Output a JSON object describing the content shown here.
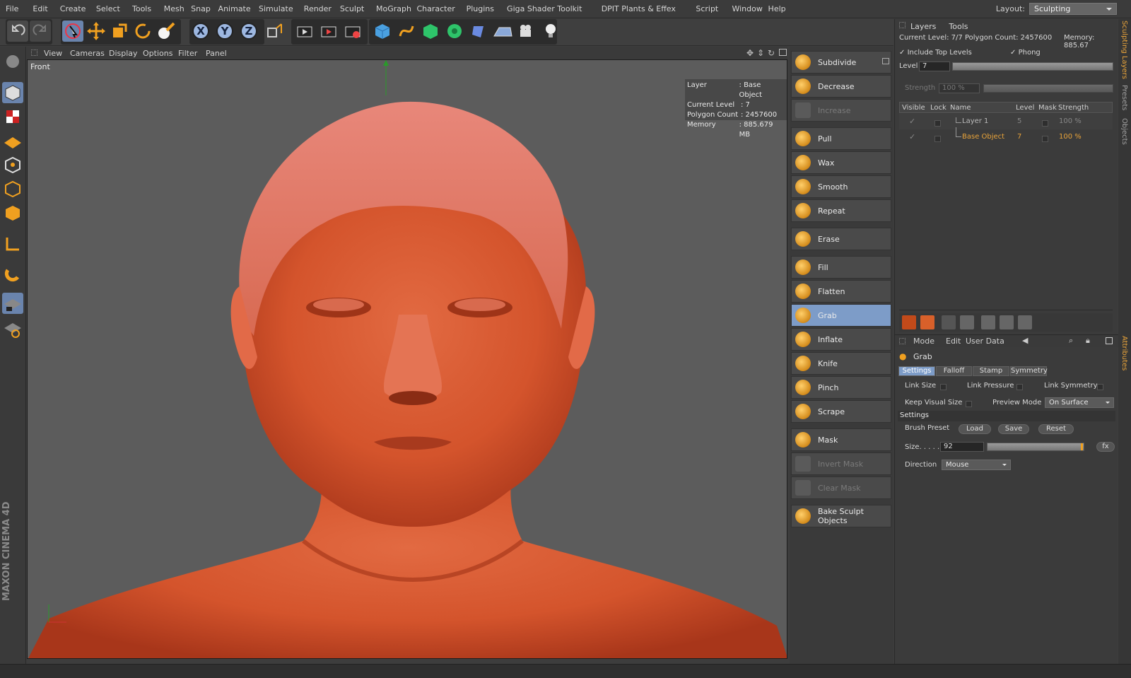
{
  "menu": [
    "File",
    "Edit",
    "Create",
    "Select",
    "Tools",
    "Mesh",
    "Snap",
    "Animate",
    "Simulate",
    "Render",
    "Sculpt",
    "MoGraph",
    "Character",
    "Plugins",
    "Giga Shader Toolkit",
    "DPIT Plants & Effex",
    "Script",
    "Window",
    "Help"
  ],
  "layout": {
    "label": "Layout:",
    "value": "Sculpting"
  },
  "axes": [
    "X",
    "Y",
    "Z"
  ],
  "viewport_menu": [
    "View",
    "Cameras",
    "Display",
    "Options",
    "Filter",
    "Panel"
  ],
  "viewport": {
    "label": "Front",
    "hud": [
      {
        "k": "Layer",
        "v": ": Base Object"
      },
      {
        "k": "Current Level",
        "v": ": 7"
      },
      {
        "k": "Polygon Count",
        "v": ": 2457600"
      },
      {
        "k": "Memory",
        "v": ": 885.679 MB"
      }
    ]
  },
  "brand": "MAXON CINEMA 4D",
  "sculpt_tools": [
    {
      "label": "Subdivide",
      "state": "normal",
      "group": 0
    },
    {
      "label": "Decrease",
      "state": "normal",
      "group": 0
    },
    {
      "label": "Increase",
      "state": "disabled",
      "group": 0
    },
    {
      "label": "Pull",
      "state": "normal",
      "group": 1
    },
    {
      "label": "Wax",
      "state": "normal",
      "group": 1
    },
    {
      "label": "Smooth",
      "state": "normal",
      "group": 1
    },
    {
      "label": "Repeat",
      "state": "normal",
      "group": 1
    },
    {
      "label": "Erase",
      "state": "normal",
      "group": 2
    },
    {
      "label": "Fill",
      "state": "normal",
      "group": 3
    },
    {
      "label": "Flatten",
      "state": "normal",
      "group": 3
    },
    {
      "label": "Grab",
      "state": "active",
      "group": 3
    },
    {
      "label": "Inflate",
      "state": "normal",
      "group": 3
    },
    {
      "label": "Knife",
      "state": "normal",
      "group": 3
    },
    {
      "label": "Pinch",
      "state": "normal",
      "group": 3
    },
    {
      "label": "Scrape",
      "state": "normal",
      "group": 3
    },
    {
      "label": "Mask",
      "state": "normal",
      "group": 4
    },
    {
      "label": "Invert Mask",
      "state": "disabled",
      "group": 4
    },
    {
      "label": "Clear Mask",
      "state": "disabled",
      "group": 4
    },
    {
      "label": "Bake Sculpt Objects",
      "state": "normal",
      "group": 5
    }
  ],
  "layers": {
    "tabs": [
      "Layers",
      "Tools"
    ],
    "info": "Current Level: 7/7  Polygon Count: 2457600",
    "memory": "Memory: 885.67",
    "include_top_levels": "Include Top Levels",
    "phong": "Phong",
    "level_label": "Level",
    "level_value": "7",
    "strength_label": "Strength",
    "strength_value": "100 %",
    "columns": [
      "Visible",
      "Lock",
      "Name",
      "Level",
      "Mask",
      "Strength"
    ],
    "rows": [
      {
        "name": "Layer 1",
        "level": "5",
        "strength": "100 %",
        "highlight": false
      },
      {
        "name": "Base Object",
        "level": "7",
        "strength": "100 %",
        "highlight": true
      }
    ]
  },
  "attributes": {
    "menu": [
      "Mode",
      "Edit",
      "User Data"
    ],
    "tool_name": "Grab",
    "subtabs": [
      "Settings",
      "Falloff",
      "Stamp",
      "Symmetry"
    ],
    "link_size": "Link Size",
    "link_pressure": "Link Pressure",
    "link_symmetry": "Link Symmetry",
    "keep_visual_size": "Keep Visual Size",
    "preview_mode_label": "Preview Mode",
    "preview_mode_value": "On Surface",
    "section": "Settings",
    "brush_preset": "Brush Preset",
    "load": "Load",
    "save": "Save",
    "reset": "Reset",
    "size_label": "Size. . . . .",
    "size_value": "92",
    "fx": "fx",
    "direction_label": "Direction",
    "direction_value": "Mouse"
  },
  "side_tabs": [
    "Sculpting Layers",
    "Presets",
    "Objects",
    "Attributes"
  ],
  "colors": {
    "accent": "#7d9cc8",
    "highlight_text": "#e8a33a",
    "skin": "#d9552e"
  }
}
